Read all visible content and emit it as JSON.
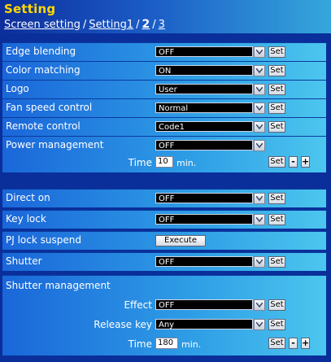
{
  "header": {
    "title": "Setting",
    "crumbs": {
      "screen_setting": "Screen setting",
      "sep1": "/",
      "setting1": "Setting1",
      "sep2": "/",
      "page2": "2",
      "sep3": "/",
      "page3": "3"
    }
  },
  "buttons": {
    "set": "Set",
    "minus": "-",
    "plus": "+",
    "execute": "Execute"
  },
  "rows": {
    "edge_blending": {
      "label": "Edge blending",
      "value": "OFF"
    },
    "color_matching": {
      "label": "Color matching",
      "value": "ON"
    },
    "logo": {
      "label": "Logo",
      "value": "User"
    },
    "fan_speed": {
      "label": "Fan speed control",
      "value": "Normal"
    },
    "remote_control": {
      "label": "Remote control",
      "value": "Code1"
    },
    "power_management": {
      "label": "Power management",
      "value": "OFF",
      "time_label": "Time",
      "time_value": "10",
      "time_unit": "min."
    },
    "direct_on": {
      "label": "Direct on",
      "value": "OFF"
    },
    "key_lock": {
      "label": "Key lock",
      "value": "OFF"
    },
    "pj_lock_suspend": {
      "label": "PJ lock suspend"
    },
    "shutter": {
      "label": "Shutter",
      "value": "OFF"
    },
    "shutter_management": {
      "label": "Shutter management",
      "effect_label": "Effect",
      "effect_value": "OFF",
      "release_label": "Release key",
      "release_value": "Any",
      "time_label": "Time",
      "time_value": "180",
      "time_unit": "min."
    }
  },
  "colors": {
    "title": "#ffd800",
    "panel_bg": "#0a2f9a",
    "row_gradient_start": "#1a66d9",
    "row_gradient_end": "#4cc6ee"
  },
  "icons": {
    "dropdown": "chevron-down-icon"
  }
}
